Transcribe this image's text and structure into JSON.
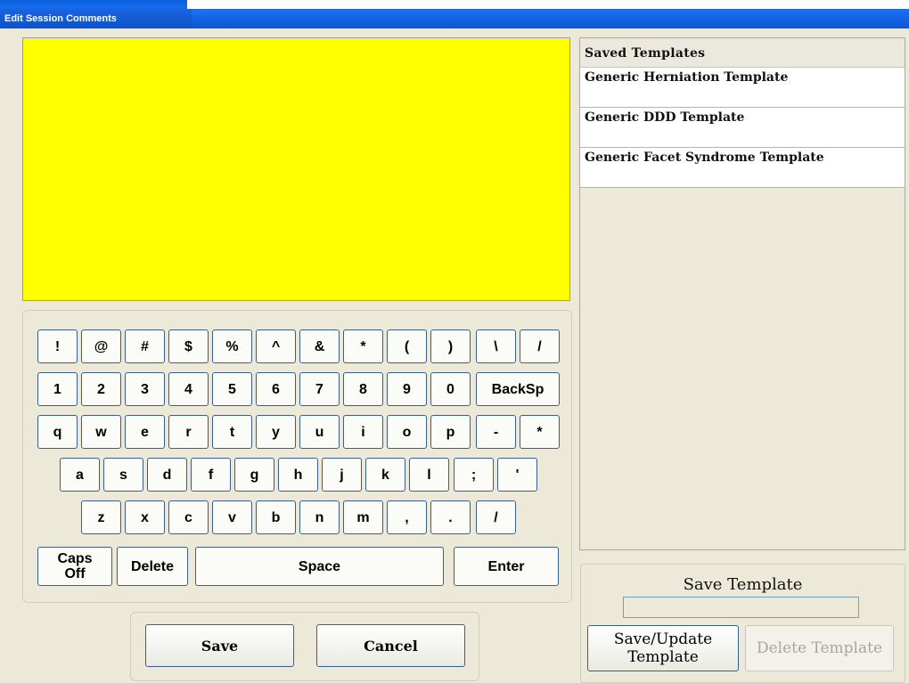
{
  "window": {
    "title": "Edit Session Comments"
  },
  "comments": {
    "value": ""
  },
  "templates": {
    "header": "Saved Templates",
    "items": [
      "Generic Herniation Template",
      "Generic DDD Template",
      "Generic Facet Syndrome Template"
    ]
  },
  "keyboard": {
    "rows": [
      [
        "!",
        "@",
        "#",
        "$",
        "%",
        "^",
        "&",
        "*",
        "(",
        ")",
        "\\",
        "/"
      ],
      [
        "1",
        "2",
        "3",
        "4",
        "5",
        "6",
        "7",
        "8",
        "9",
        "0",
        "BackSp"
      ],
      [
        "q",
        "w",
        "e",
        "r",
        "t",
        "y",
        "u",
        "i",
        "o",
        "p",
        "-",
        "*"
      ],
      [
        "a",
        "s",
        "d",
        "f",
        "g",
        "h",
        "j",
        "k",
        "l",
        ";",
        "'"
      ],
      [
        "z",
        "x",
        "c",
        "v",
        "b",
        "n",
        "m",
        ",",
        ".",
        "/"
      ],
      [
        "Caps\nOff",
        "Delete",
        "Space",
        "Enter"
      ]
    ]
  },
  "actions": {
    "save": "Save",
    "cancel": "Cancel"
  },
  "save_template": {
    "label": "Save Template",
    "name_value": "",
    "save_update": "Save/Update Template",
    "delete": "Delete Template",
    "delete_enabled": false
  },
  "colors": {
    "comment_background": "#ffff00",
    "window_background": "#ece9d8",
    "titlebar": "#0b55d4",
    "key_border": "#3a5f8a"
  }
}
